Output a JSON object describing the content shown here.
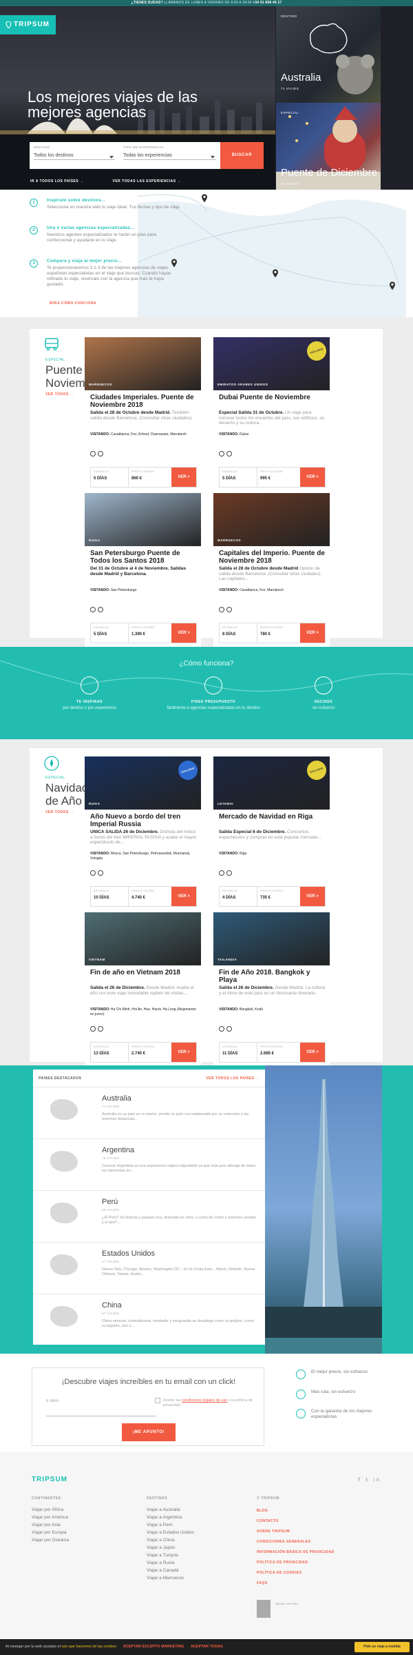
{
  "topbar": {
    "q": "¿TIENES DUDAS?",
    "rest": "LLÁMANOS DE LUNES A VIERNES DE 9:00 A 18:00",
    "phone": "+34 91 808 49 27"
  },
  "brand": {
    "name": "TRIPSUM",
    "accent": "#17bfb4",
    "cta": "#f15a40"
  },
  "hero": {
    "title": "Los mejores viajes de las mejores agencias",
    "destino_label": "DESTINO",
    "destino_value": "Todos los destinos",
    "tipo_label": "TIPO DE EXPERIENCIA",
    "tipo_value": "Todas las experiencias",
    "search": "BUSCAR",
    "link1": "IR A TODOS LOS PAÍSES →",
    "link2": "VER TODAS LAS EXPERIENCIAS →"
  },
  "tiles": [
    {
      "tag": "DESTINO",
      "title": "Australia",
      "sub": "71 VIAJES"
    },
    {
      "tag": "ESPECIAL",
      "title": "Puente de Diciembre",
      "sub": "38 VIAJES"
    }
  ],
  "steps": [
    {
      "num": "1",
      "h": "Inspírate sobre destinos...",
      "p": "Selecciona en nuestra web tu viaje ideal. Tus fechas y tipo de viaje."
    },
    {
      "num": "2",
      "h": "Una o varias agencias especializadas...",
      "p": "Nuestros agentes especializados te harán un plan para confeccionar y ayudarte en tu viaje."
    },
    {
      "num": "3",
      "h": "Compara y viaja al mejor precio...",
      "p": "Te proporcionaremos 2 ó 3 de las mejores agencias de viajes españolas especialistas en el viaje que buscas. Cuando hayas refinado tu viaje, reservalo con la agencia que más te haya gustado."
    }
  ],
  "more": "MIRA CÓMO FUNCIONA",
  "section1": {
    "kicker": "ESPECIAL",
    "title": "Puente de Noviembre",
    "link": "VER TODOS →"
  },
  "section2": {
    "kicker": "ESPECIAL",
    "title": "Navidad y Fin de Año",
    "link": "VER TODOS →"
  },
  "labels": {
    "estancia": "ESTANCIA",
    "precio": "PRECIO",
    "desde": "DESDE",
    "ver": "VER >"
  },
  "cards1": [
    {
      "loc": "MARRUECOS",
      "title": "Ciudades Imperiales. Puente de Noviembre 2018",
      "b": "Salida el 28 de Octubre desde Madrid.",
      "d": "También salida desde Barcelona. (Consultar otras ciudades).",
      "v": "Casablanca, Fez, Erfoud, Ouarzazate, Marrakech",
      "dias": "5 DÍAS",
      "price": "860 €"
    },
    {
      "loc": "EMIRATOS ÁRABES UNIDOS",
      "title": "Dubai Puente de Noviembre",
      "b": "Especial Salida 31 de Octubre.",
      "d": "Un viaje para conocer todos los encantos del país, sus edificios, su desierto y su cultura...",
      "v": "Dubai",
      "dias": "5 DÍAS",
      "price": "995 €",
      "seal": "EXCLUSIVE"
    },
    {
      "loc": "RUSIA",
      "title": "San Petersburgo Puente de Todos los Santos 2018",
      "b": "Del 31 de Octubre al 4 de Noviembre. Salidas desde Madrid y Barcelona.",
      "d": "",
      "v": "San Petersburgo",
      "dias": "5 DÍAS",
      "price": "1.390 €"
    },
    {
      "loc": "MARRUECOS",
      "title": "Capitales del Imperio. Puente de Noviembre 2018",
      "b": "Salida el 28 de Octubre desde Madrid",
      "d": "Opción de salida desde Barcelona. (Consultar otras ciudades). Las capitales...",
      "v": "Casablanca, Fez, Marrakech",
      "dias": "8 DÍAS",
      "price": "780 €"
    }
  ],
  "how": {
    "title": "¿Cómo funciona?",
    "items": [
      {
        "h": "TE INSPIRAS",
        "p": "por destino o por experiencia"
      },
      {
        "h": "PIDES PRESUPUESTO",
        "p": "fácilmente a agencias especializadas en tu destino"
      },
      {
        "h": "DECIDES",
        "p": "sin esfuerzo"
      }
    ]
  },
  "cards2": [
    {
      "loc": "RUSIA",
      "title": "Año Nuevo a bordo del tren Imperial Russia",
      "b": "ÚNICA SALIDA 26 de Diciembre.",
      "d": "Disfruta del mítico a bordo del tren IMPERIAL RUSSIA y acaba el mayor espectáculo de...",
      "v": "Moscú, San Petersburgo, Petrozavodsk, Murmansk, Vologda",
      "dias": "10 DÍAS",
      "price": "4.740 €",
      "seal": "EXCLUSIVE"
    },
    {
      "loc": "LETONIA",
      "title": "Mercado de Navidad en Riga",
      "b": "Salida Especial 6 de Diciembre.",
      "d": "Conciertos, espectáculos y compras en este popular mercado...",
      "v": "Riga",
      "dias": "4 DÍAS",
      "price": "735 €",
      "seal": "EXCLUSIVE"
    },
    {
      "loc": "VIETNAM",
      "title": "Fin de año en Vietnam 2018",
      "b": "Salida el 26 de Diciembre.",
      "d": "Desde Madrid. Acaba el año con este viaje inolvidable repleto de visitas...",
      "v": "Ha Chi Minh, Hoi An, Hue, Hanói, Ha Long (Alojamiento en junco)",
      "dias": "13 DÍAS",
      "price": "2.740 €"
    },
    {
      "loc": "TAILANDIA",
      "title": "Fin de Año 2018. Bangkok y Playa",
      "b": "Salida el 26 de Diciembre.",
      "d": "Desde Madrid. La cultura y el ritmo de este país en un fascinante itinerario.",
      "v": "Bangkok, Krabi",
      "dias": "11 DÍAS",
      "price": "2.685 €"
    }
  ],
  "countries": {
    "head": "PAÍSES DESTACADOS",
    "all": "VER TODOS LOS PAÍSES →",
    "items": [
      {
        "n": "Australia",
        "c": "71 VIAJES",
        "p": "Australia es un país en sí mismo, siendo un país con inabarcable por su extensión y las enormes distancias..."
      },
      {
        "n": "Argentina",
        "c": "72 VIAJES",
        "p": "Conocer Argentina es una experiencia viajera inigualable ya que este país alberga de todos los elementos en..."
      },
      {
        "n": "Perú",
        "c": "59 VIAJES",
        "p": "¿El Perú? Su historia y pasado inca. Animada en cima, o cumo de Cristo y enormes vendes y el aire?..."
      },
      {
        "n": "Estados Unidos",
        "c": "47 VIAJES",
        "p": "Nueva York, Chicago, Boston, Washington DC... En la Costa Este... Miami, Orlando, Nueva Orleans, Tampa, Austin..."
      },
      {
        "n": "China",
        "c": "57 VIAJES",
        "p": "China sensual, contradictoria, mediador y vanguardia se despliega como su prójimo, como su lúgubre, aún n..."
      }
    ]
  },
  "news": {
    "title": "¡Descubre viajes increíbles en tu email con un click!",
    "email": "E-MAIL",
    "consent_a": "Acepto las",
    "consent_link": "condiciones legales de uso",
    "consent_b": "y la política de privacidad",
    "btn": "¡ME APUNTO!"
  },
  "perks": [
    "El mejor precio, sin esfuerzo",
    "Más ruta, sin esfuerzo",
    "Con la garantía de los mejores especialistas"
  ],
  "footer": {
    "logo": "TRIPSUM",
    "social": "𝕗 𝕥 in",
    "cont_h": "CONTINENTES",
    "cont": [
      "Viajar por África",
      "Viajar por América",
      "Viajar por Asia",
      "Viajar por Europa",
      "Viajar por Oceanía"
    ],
    "dest_h": "DESTINOS",
    "dest": [
      "Viajar a Australia",
      "Viajar a Argentina",
      "Viajar a Perú",
      "Viajar a Estados Unidos",
      "Viajar a China",
      "Viajar a Japón",
      "Viajar a Turquía",
      "Viajar a Rusia",
      "Viajar a Canadá",
      "Viajar a Marruecos"
    ],
    "trip_h": "© TRIPSUM",
    "trip": [
      "BLOG",
      "CONTACTO",
      "SOBRE TRIPSUM",
      "CONDICIONES GENERALES",
      "INFORMACIÓN BÁSICA DE PRIVACIDAD",
      "POLÍTICA DE PRIVACIDAD",
      "POLÍTICA DE COOKIES",
      "FAQS"
    ],
    "enac": "Miembro de ENAC"
  },
  "cookie": {
    "text": "Al navegar por la web aceptas el",
    "link": "uso que hacemos de las cookies",
    "accept": "ACEPTAR EXCEPTO MARKETING",
    "all": "ACEPTAR TODAS",
    "chat": "Pide un viaje a medida"
  }
}
